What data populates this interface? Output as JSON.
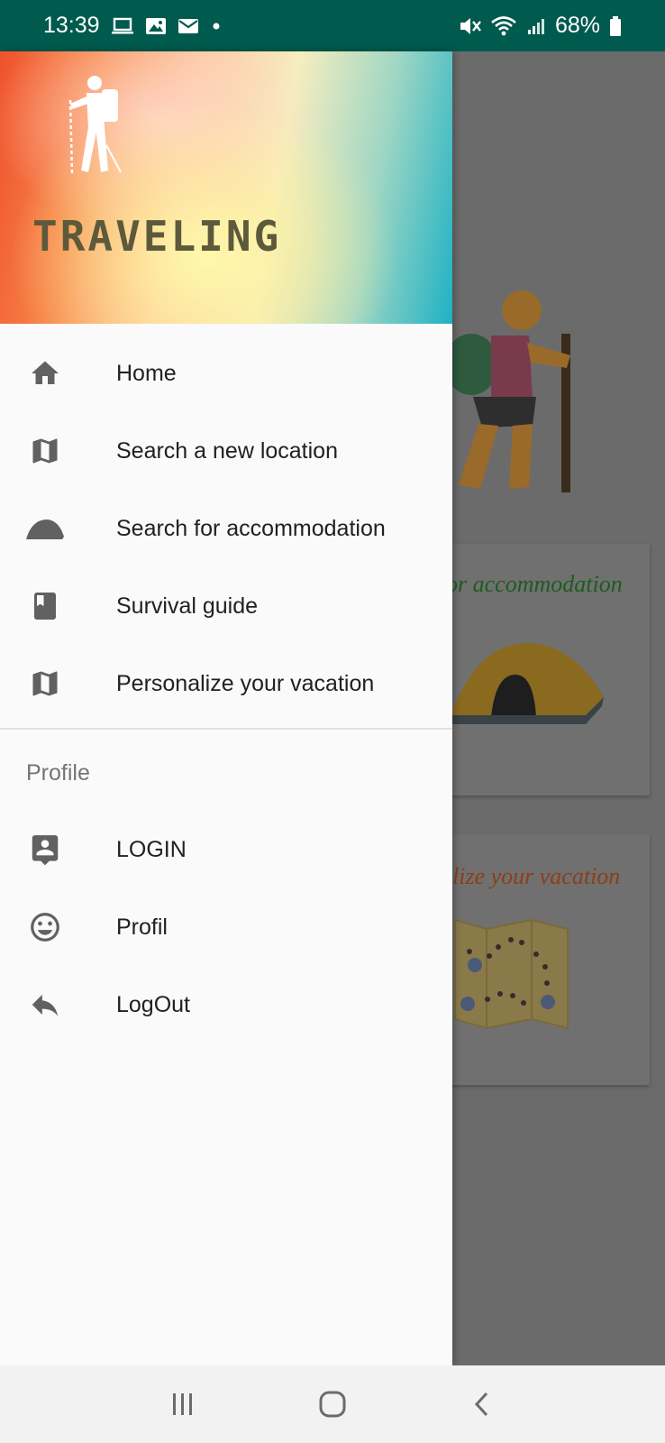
{
  "status_bar": {
    "time": "13:39",
    "battery": "68%"
  },
  "drawer": {
    "header_title": "TRAVELING",
    "items": [
      {
        "label": "Home",
        "icon": "home-icon"
      },
      {
        "label": "Search a new location",
        "icon": "map-icon"
      },
      {
        "label": "Search for accommodation",
        "icon": "tent-icon"
      },
      {
        "label": "Survival guide",
        "icon": "book-icon"
      },
      {
        "label": "Personalize your vacation",
        "icon": "map-icon"
      }
    ],
    "section_title": "Profile",
    "profile_items": [
      {
        "label": "LOGIN",
        "icon": "account-box-icon"
      },
      {
        "label": "Profil",
        "icon": "smiley-icon"
      },
      {
        "label": "LogOut",
        "icon": "reply-icon"
      }
    ]
  },
  "background": {
    "card1_text": "or accommodation",
    "card2_text": "lize your vacation"
  },
  "colors": {
    "status_bar": "#005a4e",
    "icon": "#616161",
    "card1_text": "#1e5b1e",
    "card2_text": "#8a3f16"
  }
}
